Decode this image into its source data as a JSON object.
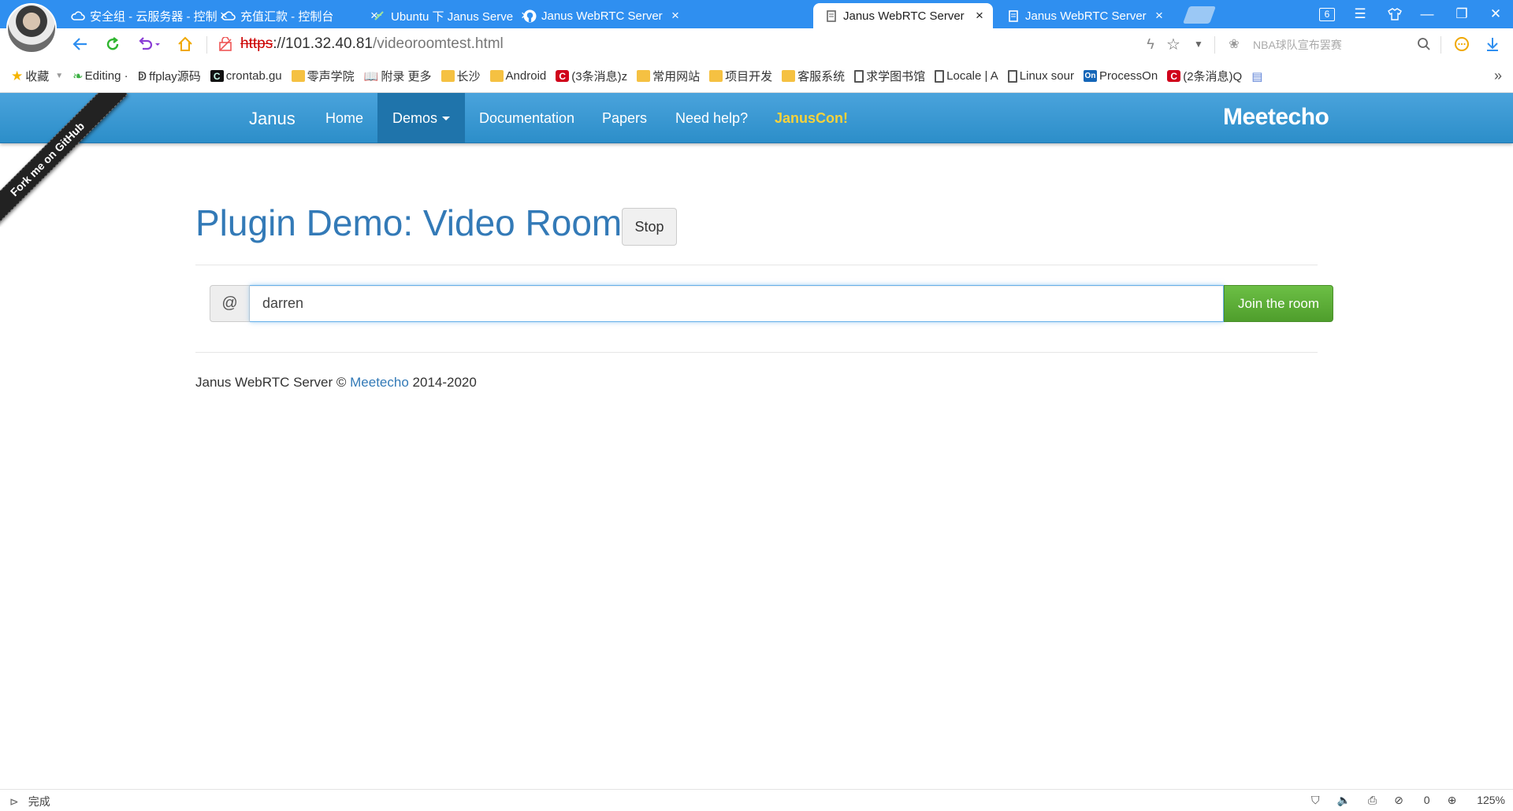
{
  "tabs": [
    {
      "title": "安全组 - 云服务器 - 控制",
      "icon": "cloud-icon",
      "active": false
    },
    {
      "title": "充值汇款 - 控制台",
      "icon": "cloud-icon",
      "active": false
    },
    {
      "title": "Ubuntu 下 Janus Serve",
      "icon": "feather-icon",
      "active": false
    },
    {
      "title": "Janus WebRTC Server",
      "icon": "github-icon",
      "active": false
    },
    {
      "title": "Janus WebRTC Server",
      "icon": "page-icon",
      "active": true
    },
    {
      "title": "Janus WebRTC Server",
      "icon": "page-icon",
      "active": false
    }
  ],
  "window": {
    "tab_count": "6"
  },
  "address": {
    "protocol": "https",
    "host": "://101.32.40.81",
    "path": "/videoroomtest.html"
  },
  "search": {
    "placeholder": "NBA球队宣布罢赛"
  },
  "bookmarks": [
    {
      "label": "收藏",
      "icon": "star-icon"
    },
    {
      "label": "Editing ·",
      "icon": "leaf-icon"
    },
    {
      "label": "ffplay源码",
      "icon": "squiggle-icon"
    },
    {
      "label": "crontab.gu",
      "icon": "c-icon"
    },
    {
      "label": "零声学院",
      "icon": "folder-icon"
    },
    {
      "label": "附录 更多",
      "icon": "book-icon"
    },
    {
      "label": "长沙",
      "icon": "folder-icon"
    },
    {
      "label": "Android",
      "icon": "folder-icon"
    },
    {
      "label": "(3条消息)z",
      "icon": "csdn-icon"
    },
    {
      "label": "常用网站",
      "icon": "folder-icon"
    },
    {
      "label": "项目开发",
      "icon": "folder-icon"
    },
    {
      "label": "客服系统",
      "icon": "folder-icon"
    },
    {
      "label": "求学图书馆",
      "icon": "doc-icon"
    },
    {
      "label": "Locale | A",
      "icon": "doc-icon"
    },
    {
      "label": "Linux sour",
      "icon": "doc-icon"
    },
    {
      "label": "ProcessOn",
      "icon": "processon-icon"
    },
    {
      "label": "(2条消息)Q",
      "icon": "csdn-icon"
    }
  ],
  "janus_nav": {
    "brand": "Janus",
    "home": "Home",
    "demos": "Demos",
    "documentation": "Documentation",
    "papers": "Papers",
    "help": "Need help?",
    "januscon": "JanusCon!",
    "logo": "Meetecho",
    "ribbon": "Fork me on GitHub"
  },
  "main": {
    "title": "Plugin Demo: Video Room",
    "stop_label": "Stop",
    "at_symbol": "@",
    "username_value": "darren",
    "join_label": "Join the room"
  },
  "footer": {
    "prefix": "Janus WebRTC Server © ",
    "link": "Meetecho",
    "suffix": " 2014-2020"
  },
  "status": {
    "text": "完成",
    "blocked_count": "0",
    "zoom": "125%"
  },
  "colors": {
    "nav_blue": "#2c8ec9",
    "title_blue": "#337ab7",
    "join_green": "#5cb034",
    "januscon_yellow": "#f6d23b"
  }
}
